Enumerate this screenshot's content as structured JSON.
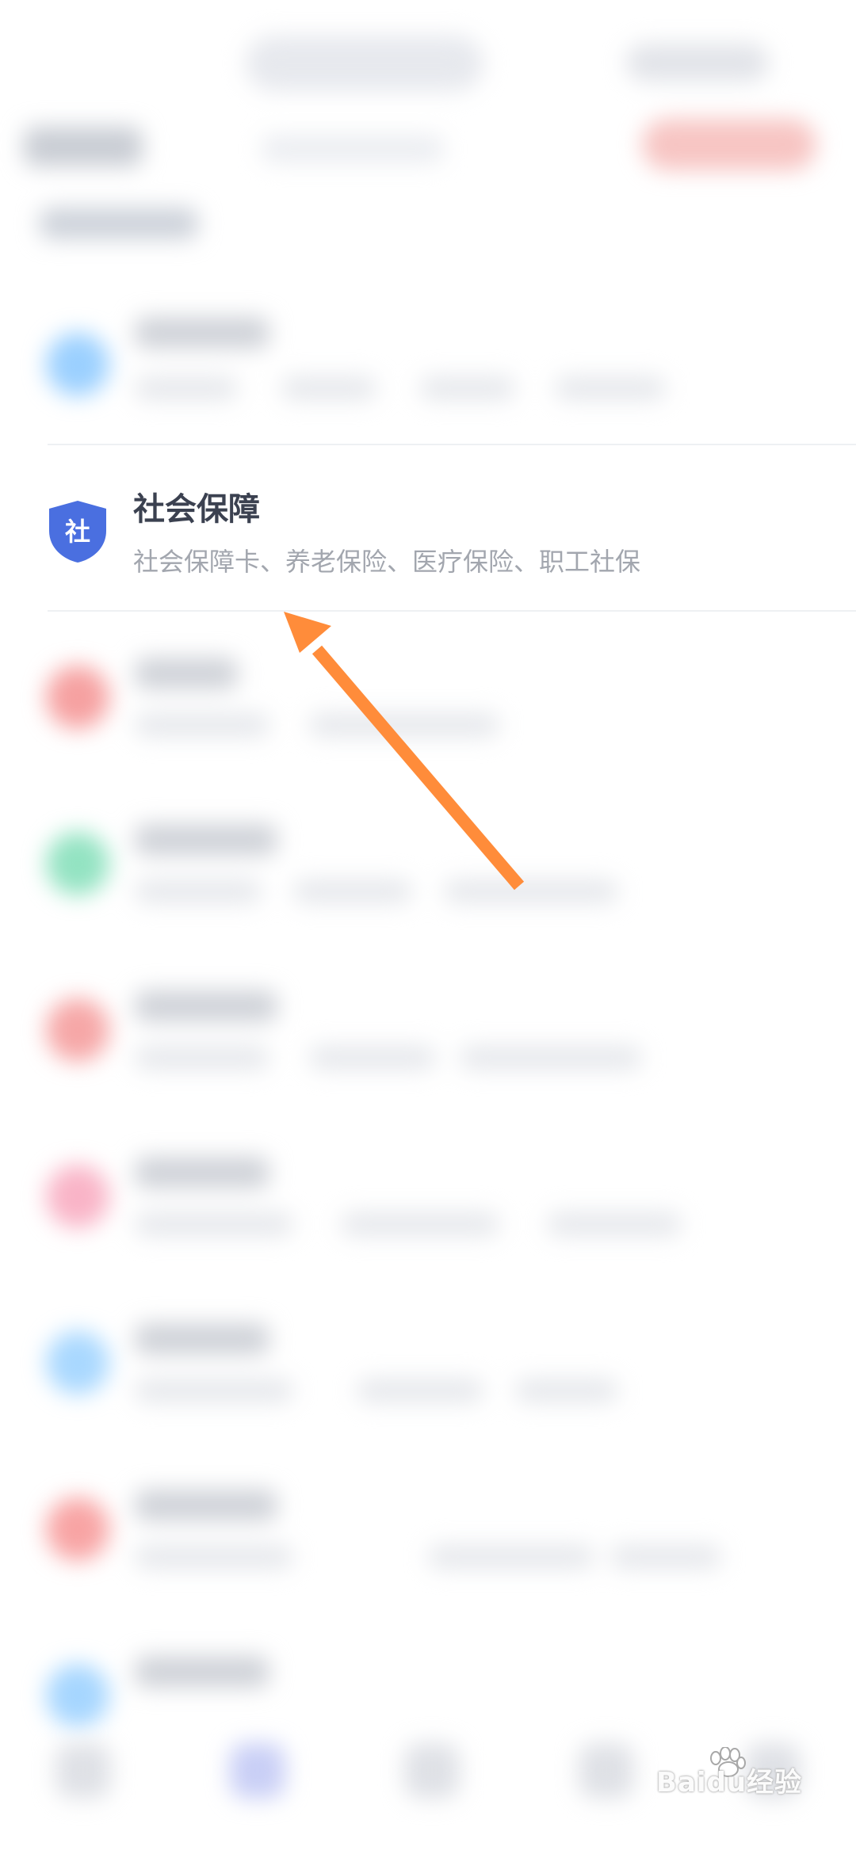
{
  "social_security": {
    "icon_glyph": "社",
    "title": "社会保障",
    "subtitle": "社会保障卡、养老保险、医疗保险、职工社保"
  },
  "watermark": {
    "text": "Baidu经验"
  },
  "colors": {
    "shield": "#4a6fe0",
    "arrow": "#ff8c3a",
    "title": "#3b4150",
    "subtitle": "#a2a6ae"
  },
  "blurred_row_colors": [
    "#9bd0ff",
    "#f6a1a1",
    "#93e3c2",
    "#f6a7a7",
    "#f9b4c7",
    "#a9d8ff",
    "#f8a4a4",
    "#a6d6ff"
  ]
}
